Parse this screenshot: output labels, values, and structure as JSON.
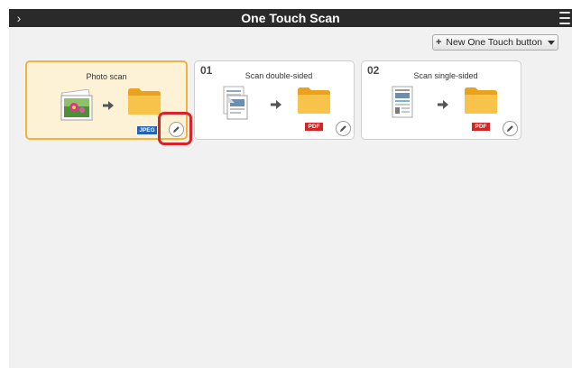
{
  "window": {
    "title": "One Touch Scan",
    "nav_glyph": "›",
    "menu_icon": "hamburger-icon"
  },
  "toolbar": {
    "new_button_label": "New One Touch button",
    "plus_glyph": "+"
  },
  "cards": [
    {
      "number": "",
      "title": "Photo scan",
      "format": "JPEG",
      "selected": true,
      "highlighted_edit": true
    },
    {
      "number": "01",
      "title": "Scan double-sided",
      "format": "PDF",
      "selected": false
    },
    {
      "number": "02",
      "title": "Scan single-sided",
      "format": "PDF",
      "selected": false
    }
  ],
  "colors": {
    "titlebar": "#2a2a2a",
    "selected_card_bg": "#fdf2d6",
    "selected_card_border": "#f0b33e",
    "folder": "#f7b733",
    "pdf_badge": "#d32626",
    "jpeg_badge": "#1f64b5",
    "highlight": "#d8232a"
  }
}
